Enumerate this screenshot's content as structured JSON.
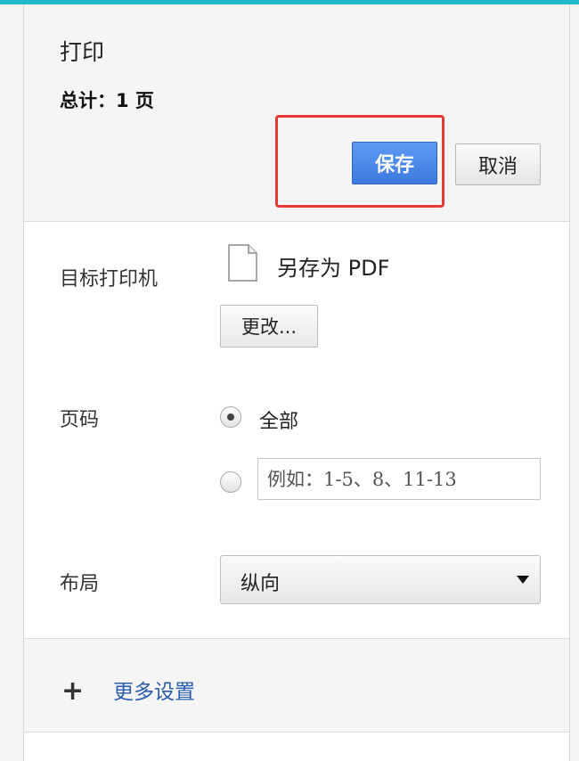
{
  "header": {
    "title": "打印",
    "total_label": "总计：",
    "total_value": "1 页",
    "save_label": "保存",
    "cancel_label": "取消"
  },
  "destination": {
    "label": "目标打印机",
    "name": "另存为 PDF",
    "icon": "document-icon",
    "change_label": "更改..."
  },
  "pages": {
    "label": "页码",
    "options": [
      {
        "label": "全部",
        "selected": true
      },
      {
        "label": "",
        "selected": false
      }
    ],
    "range_placeholder": "例如：1-5、8、11-13"
  },
  "layout": {
    "label": "布局",
    "selected": "纵向"
  },
  "more": {
    "icon": "plus-icon",
    "label": "更多设置"
  },
  "colors": {
    "accent_top": "#25b8c8",
    "save_button": "#3c79e0",
    "highlight_box": "#e53935",
    "link": "#2a5db0"
  }
}
